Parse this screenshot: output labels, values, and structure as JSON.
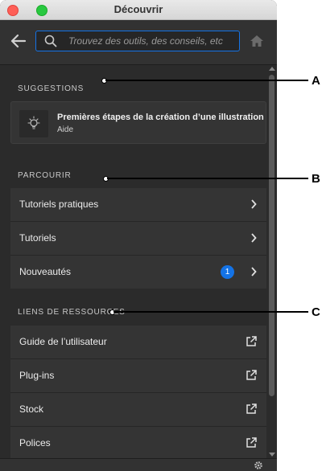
{
  "window": {
    "title": "Découvrir"
  },
  "search": {
    "placeholder": "Trouvez des outils, des conseils, etc"
  },
  "sections": {
    "suggestions": "SUGGESTIONS",
    "browse": "PARCOURIR",
    "resources": "LIENS DE RESSOURCES"
  },
  "suggestion": {
    "title": "Premières étapes de la création d’une illustration",
    "subtitle": "Aide",
    "icon": "lightbulb-icon"
  },
  "browse_items": [
    {
      "label": "Tutoriels pratiques"
    },
    {
      "label": "Tutoriels"
    },
    {
      "label": "Nouveautés",
      "badge": "1"
    }
  ],
  "resource_items": [
    {
      "label": "Guide de l’utilisateur"
    },
    {
      "label": "Plug-ins"
    },
    {
      "label": "Stock"
    },
    {
      "label": "Polices"
    }
  ],
  "callouts": {
    "a": "A",
    "b": "B",
    "c": "C"
  },
  "colors": {
    "accent": "#1473e6",
    "panel": "#2b2b2b"
  }
}
